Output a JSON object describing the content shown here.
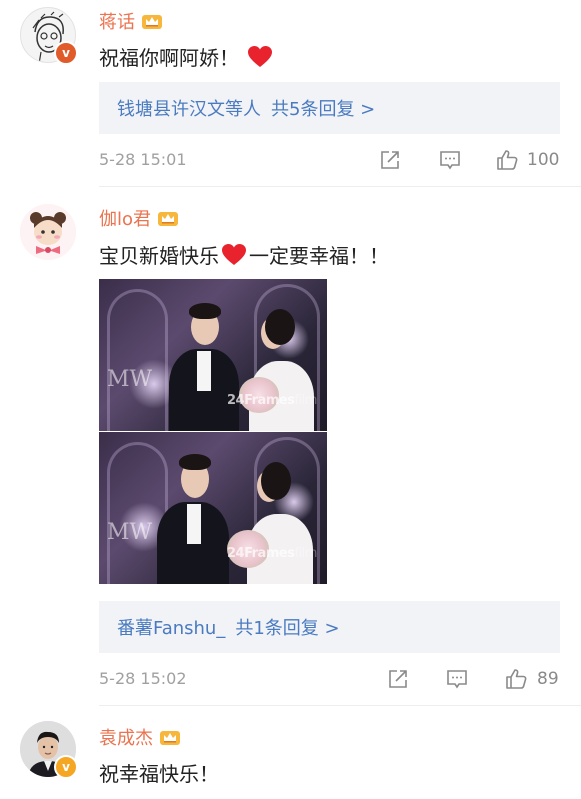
{
  "colors": {
    "username": "#eb7350",
    "link": "#4a7bc0",
    "reply_bg": "#f2f3f7",
    "meta_text": "#a0a0a0",
    "heart": "#e8232e"
  },
  "comments": [
    {
      "username": "蒋话",
      "avatar_icon": "cartoon-avatar-icon",
      "badge_icon": "verified-v-badge-icon",
      "text": "祝福你啊阿娇！",
      "has_heart_after": true,
      "reply_summary": {
        "names": "钱塘县许汉文等人",
        "more": "共5条回复 >"
      },
      "time": "5-28 15:01",
      "likes": "100"
    },
    {
      "username": "伽lo君",
      "avatar_icon": "girl-avatar-icon",
      "text_before_heart": "宝贝新婚快乐",
      "text_after_heart": "一定要幸福！！",
      "images": [
        {
          "watermark": "24Frames",
          "watermark_faded": "film",
          "monogram": "MW"
        },
        {
          "watermark": "24Frames",
          "watermark_faded": "film",
          "monogram": "MW"
        }
      ],
      "reply_summary": {
        "names": "番薯Fanshu_",
        "more": "共1条回复 >"
      },
      "time": "5-28 15:02",
      "likes": "89"
    },
    {
      "username": "袁成杰",
      "avatar_icon": "man-avatar-icon",
      "badge_icon": "verified-v-badge-icon",
      "text": "祝幸福快乐！"
    }
  ]
}
